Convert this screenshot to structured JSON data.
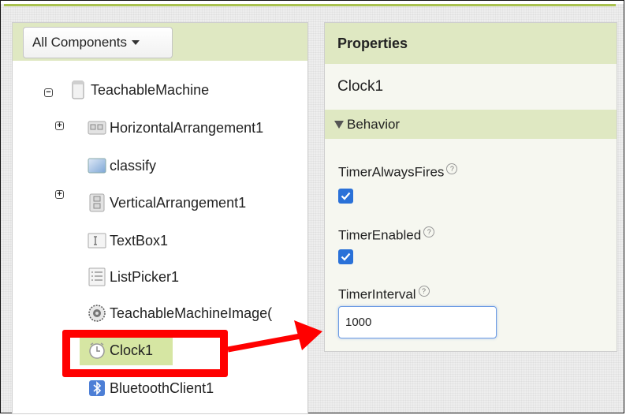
{
  "components_dropdown": {
    "label": "All Components"
  },
  "tree": [
    {
      "label": "TeachableMachine",
      "toggle": "−",
      "icon": "screen-icon"
    },
    {
      "label": "HorizontalArrangement1",
      "toggle": "+",
      "icon": "horizontal-arrangement-icon"
    },
    {
      "label": "classify",
      "toggle": "",
      "icon": "button-icon"
    },
    {
      "label": "VerticalArrangement1",
      "toggle": "+",
      "icon": "vertical-arrangement-icon"
    },
    {
      "label": "TextBox1",
      "toggle": "",
      "icon": "textbox-icon"
    },
    {
      "label": "ListPicker1",
      "toggle": "",
      "icon": "listpicker-icon"
    },
    {
      "label": "TeachableMachineImage(",
      "toggle": "",
      "icon": "teachable-machine-image-icon"
    },
    {
      "label": "Clock1",
      "toggle": "",
      "icon": "clock-icon"
    },
    {
      "label": "BluetoothClient1",
      "toggle": "",
      "icon": "bluetooth-icon"
    }
  ],
  "properties": {
    "header": "Properties",
    "component": "Clock1",
    "section": "Behavior",
    "timer_always_fires": {
      "label": "TimerAlwaysFires",
      "help": "?",
      "checked": true
    },
    "timer_enabled": {
      "label": "TimerEnabled",
      "help": "?",
      "checked": true
    },
    "timer_interval": {
      "label": "TimerInterval",
      "help": "?",
      "value": "1000"
    }
  },
  "colors": {
    "header_green": "#dfe8c2",
    "checkbox_blue": "#2a71d8",
    "annotation_red": "#ff0000"
  }
}
